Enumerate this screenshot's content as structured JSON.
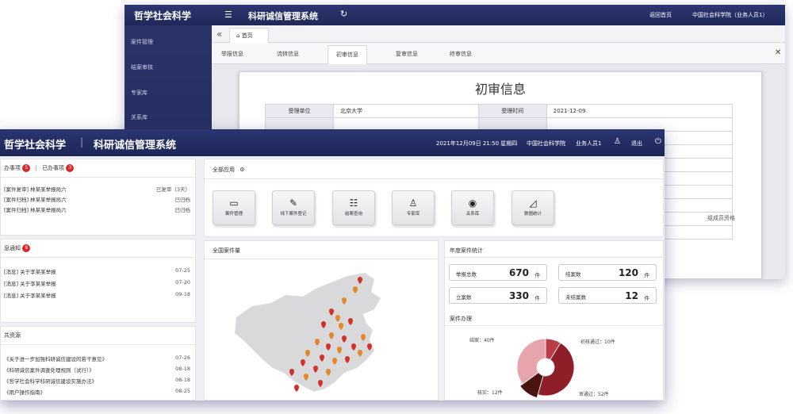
{
  "back": {
    "brand": "哲学社会科学",
    "system_title": "科研诚信管理系统",
    "home_link": "返回首页",
    "user": "中国社会科学院（业务人员1）",
    "sidebar": [
      "案件管理",
      "结案审核",
      "专家库",
      "关系库"
    ],
    "tab_home": "首页",
    "sub_tabs": [
      "举报信息",
      "流转信息",
      "初审信息",
      "复审信息",
      "终审信息"
    ],
    "page_title": "初审信息",
    "table": [
      {
        "l1": "受理单位",
        "v1": "北京大学",
        "l2": "受理时间",
        "v2": "2021-12-09"
      },
      {
        "l1": "",
        "v1": "",
        "l2": "",
        "v2": ""
      },
      {
        "l1": "",
        "v1": "",
        "l2": "",
        "v2": ""
      },
      {
        "l1": "",
        "v1": "",
        "l2": "",
        "v2": ""
      },
      {
        "l1": "",
        "v1": "",
        "l2": "",
        "v2": ""
      },
      {
        "l1": "",
        "v1": "",
        "l2": "",
        "v2": ""
      },
      {
        "l1": "",
        "v1": "",
        "l2": "",
        "v2": ""
      },
      {
        "l1": "",
        "v1": "",
        "l2": "",
        "v2": ""
      },
      {
        "l1": "",
        "v1": "",
        "l2": "",
        "v2": ""
      },
      {
        "l1": "",
        "v1": "",
        "l2": "",
        "v2": ""
      }
    ],
    "snippet": "组成员资格"
  },
  "front": {
    "brand": "哲学社会科学",
    "system_title": "科研诚信管理系统",
    "datetime": "2021年12月09日 21:50 星期四",
    "org": "中国社会科学院",
    "user": "业务人员1",
    "logout": "退出",
    "todo": {
      "tab_pending": "办事项",
      "pending_count": "5",
      "tab_done": "已办事项",
      "done_count": "3",
      "items": [
        {
          "text": "[案件复审] 林某某举报局六",
          "status": "已复审（3天）"
        },
        {
          "text": "[案件归档] 林某某举报局六",
          "status": "已归档"
        },
        {
          "text": "[案件归档] 林某某举报局六",
          "status": "已归档"
        }
      ]
    },
    "messages": {
      "title": "息通知",
      "count": "9",
      "items": [
        {
          "text": "[消息] 关于李某某举报",
          "date": "07-25"
        },
        {
          "text": "[消息] 关于李某某举报",
          "date": "07-20"
        },
        {
          "text": "[消息] 关于李某某举报",
          "date": "09-18"
        }
      ]
    },
    "resources": {
      "title": "共资源",
      "items": [
        {
          "text": "《关于进一步加强科研诚信建设的若干意见》",
          "date": "07-26"
        },
        {
          "text": "《科研诚信案件调查处理规则（试行）》",
          "date": "08-18"
        },
        {
          "text": "《哲学社会科学科研诚信建设实施办法》",
          "date": "08-18"
        },
        {
          "text": "《用户操作指南》",
          "date": "08-25"
        }
      ]
    },
    "apps": {
      "title": "全部应用",
      "items": [
        {
          "label": "案件管理",
          "icon": "▭"
        },
        {
          "label": "线下案件登记",
          "icon": "✎"
        },
        {
          "label": "结案查询",
          "icon": "☷"
        },
        {
          "label": "专家库",
          "icon": "♙"
        },
        {
          "label": "关系库",
          "icon": "◉"
        },
        {
          "label": "数据统计",
          "icon": "◿"
        }
      ]
    },
    "map_title": "全国案件量",
    "map_colors": {
      "marker_red": "#d4302b",
      "marker_orange": "#e3862c",
      "land": "#d9d9dc"
    },
    "stats": {
      "title": "年度案件统计",
      "unit": "件",
      "items": [
        {
          "label": "举报总数",
          "value": "670"
        },
        {
          "label": "结案数",
          "value": "120"
        },
        {
          "label": "立案数",
          "value": "330"
        },
        {
          "label": "未结案数",
          "value": "12"
        }
      ]
    },
    "case_chart_title": "案件办理",
    "chart_data": {
      "type": "pie",
      "title": "案件办理",
      "unit": "件",
      "slices": [
        {
          "label": "初核通过",
          "value": 10,
          "color": "#b83e49"
        },
        {
          "label": "审通过",
          "value": 52,
          "color": "#8e1f28"
        },
        {
          "label": "核实",
          "value": 12,
          "color": "#4a1412"
        },
        {
          "label": "结案",
          "value": 40,
          "color": "#e7a4aa"
        }
      ],
      "labels_text": [
        "初核通过：10件",
        "审通过：52件",
        "核实：12件",
        "结案：40件"
      ]
    }
  }
}
